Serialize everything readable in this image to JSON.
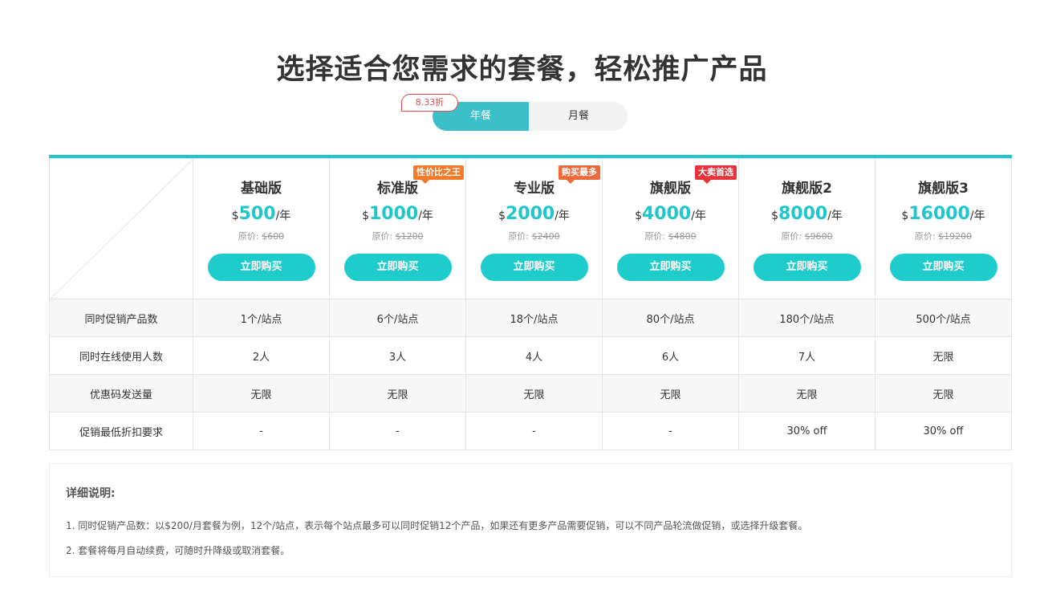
{
  "title": "选择适合您需求的套餐，轻松推广产品",
  "billing_toggle": {
    "discount_tag": "8.33折",
    "yearly_label": "年餐",
    "monthly_label": "月餐",
    "selected": "yearly"
  },
  "colors": {
    "accent": "#1fc6cc",
    "button": "#1fcccc",
    "toggle_active": "#3bbfc8"
  },
  "plans": [
    {
      "name": "基础版",
      "currency": "$",
      "price": "500",
      "unit": "/年",
      "orig_label": "原价:",
      "orig_price": "$600",
      "buy_label": "立即购买",
      "badge": null
    },
    {
      "name": "标准版",
      "currency": "$",
      "price": "1000",
      "unit": "/年",
      "orig_label": "原价:",
      "orig_price": "$1200",
      "buy_label": "立即购买",
      "badge": {
        "text": "性价比之王",
        "color": "#f47a2a"
      }
    },
    {
      "name": "专业版",
      "currency": "$",
      "price": "2000",
      "unit": "/年",
      "orig_label": "原价:",
      "orig_price": "$2400",
      "buy_label": "立即购买",
      "badge": {
        "text": "购买最多",
        "color": "#ef6a3a"
      }
    },
    {
      "name": "旗舰版",
      "currency": "$",
      "price": "4000",
      "unit": "/年",
      "orig_label": "原价:",
      "orig_price": "$4800",
      "buy_label": "立即购买",
      "badge": {
        "text": "大卖首选",
        "color": "#e8333a"
      }
    },
    {
      "name": "旗舰版2",
      "currency": "$",
      "price": "8000",
      "unit": "/年",
      "orig_label": "原价:",
      "orig_price": "$9600",
      "buy_label": "立即购买",
      "badge": null
    },
    {
      "name": "旗舰版3",
      "currency": "$",
      "price": "16000",
      "unit": "/年",
      "orig_label": "原价:",
      "orig_price": "$19200",
      "buy_label": "立即购买",
      "badge": null
    }
  ],
  "features": [
    {
      "label": "同时促销产品数",
      "values": [
        "1个/站点",
        "6个/站点",
        "18个/站点",
        "80个/站点",
        "180个/站点",
        "500个/站点"
      ]
    },
    {
      "label": "同时在线使用人数",
      "values": [
        "2人",
        "3人",
        "4人",
        "6人",
        "7人",
        "无限"
      ]
    },
    {
      "label": "优惠码发送量",
      "values": [
        "无限",
        "无限",
        "无限",
        "无限",
        "无限",
        "无限"
      ]
    },
    {
      "label": "促销最低折扣要求",
      "values": [
        "-",
        "-",
        "-",
        "-",
        "30% off",
        "30% off"
      ]
    }
  ],
  "notes": {
    "title": "详细说明:",
    "items": [
      "1. 同时促销产品数：以$200/月套餐为例，12个/站点，表示每个站点最多可以同时促销12个产品，如果还有更多产品需要促销，可以不同产品轮流做促销，或选择升级套餐。",
      "2. 套餐将每月自动续费，可随时升降级或取消套餐。"
    ]
  }
}
